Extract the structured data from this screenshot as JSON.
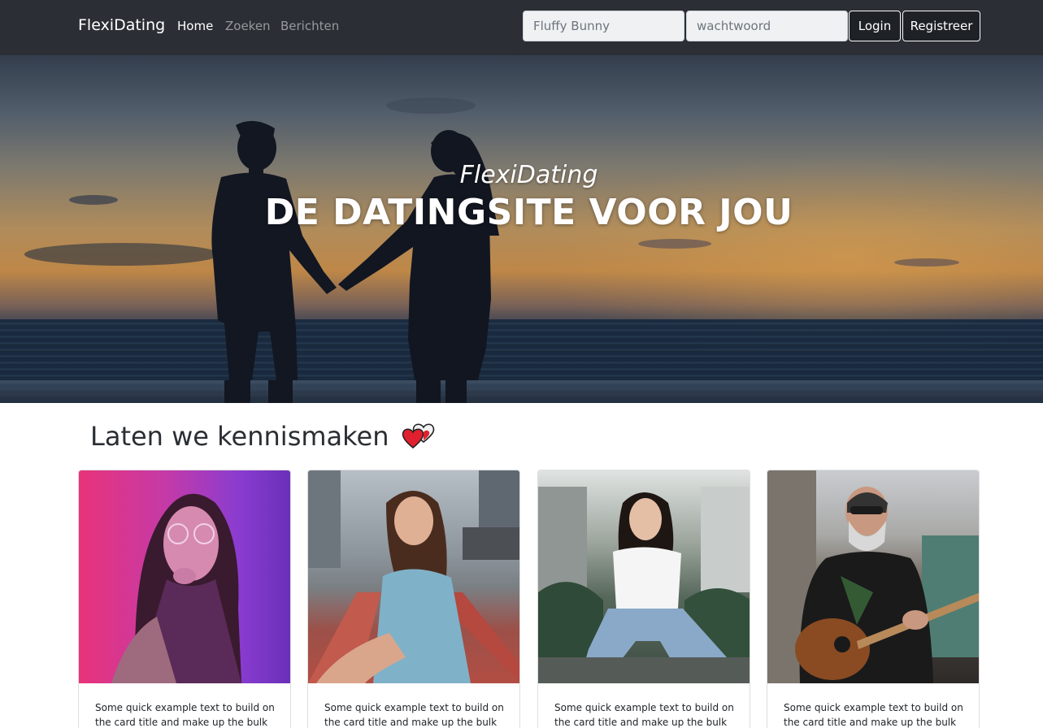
{
  "navbar": {
    "brand": "FlexiDating",
    "links": [
      {
        "label": "Home",
        "active": true
      },
      {
        "label": "Zoeken",
        "active": false
      },
      {
        "label": "Berichten",
        "active": false
      }
    ],
    "username_placeholder": "Fluffy Bunny",
    "password_placeholder": "wachtwoord",
    "login_label": "Login",
    "register_label": "Registreer"
  },
  "hero": {
    "subtitle": "FlexiDating",
    "title": "DE DATINGSITE VOOR JOU"
  },
  "section": {
    "heading": "Laten we kennismaken",
    "heading_icon": "two-hearts-icon"
  },
  "cards": [
    {
      "image": "woman-neon-portrait-photo",
      "text": "Some quick example text to build on the card title and make up the bulk of"
    },
    {
      "image": "woman-reaching-hand-photo",
      "text": "Some quick example text to build on the card title and make up the bulk of"
    },
    {
      "image": "woman-sitting-outdoors-photo",
      "text": "Some quick example text to build on the card title and make up the bulk of"
    },
    {
      "image": "man-playing-guitar-photo",
      "text": "Some quick example text to build on the card title and make up the bulk of"
    }
  ],
  "colors": {
    "navbar_bg": "#2b2f35",
    "heart_red": "#e0202e"
  }
}
